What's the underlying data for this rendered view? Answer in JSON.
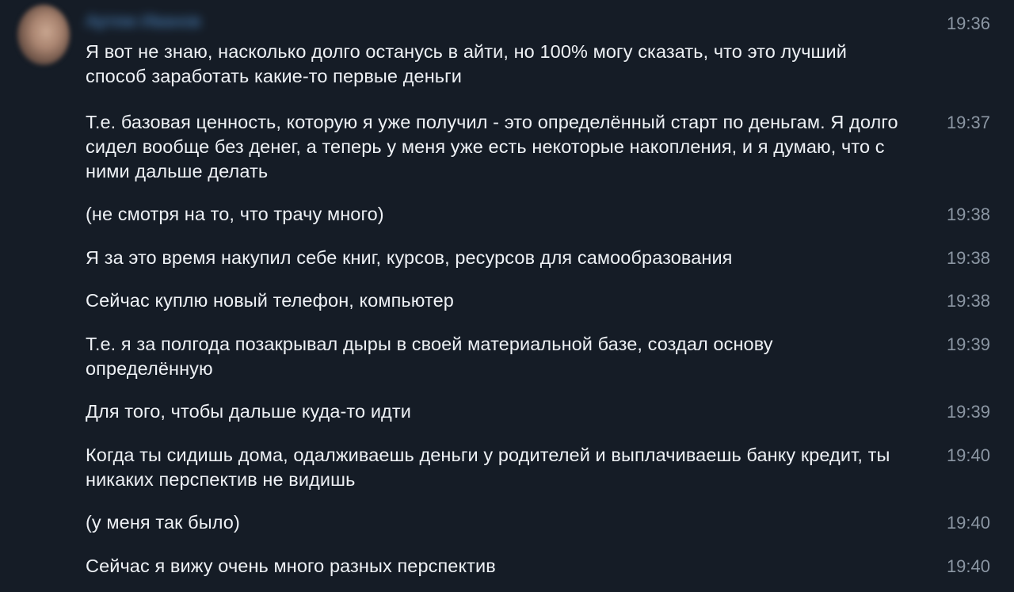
{
  "sender": {
    "name": "Артем Иванов"
  },
  "messages": [
    {
      "text": "Я вот не знаю, насколько долго останусь в айти, но 100% могу сказать, что это лучший способ заработать какие-то первые деньги",
      "time": "19:36"
    },
    {
      "text": "Т.е. базовая ценность, которую я уже получил - это определённый старт по деньгам. Я долго сидел вообще без денег, а теперь у меня уже есть некоторые накопления, и я думаю, что с ними дальше делать",
      "time": "19:37"
    },
    {
      "text": "(не смотря на то, что трачу много)",
      "time": "19:38"
    },
    {
      "text": "Я за это время накупил себе книг, курсов, ресурсов для самообразования",
      "time": "19:38"
    },
    {
      "text": "Сейчас куплю новый телефон, компьютер",
      "time": "19:38"
    },
    {
      "text": "Т.е. я за полгода позакрывал дыры в своей материальной базе, создал основу определённую",
      "time": "19:39"
    },
    {
      "text": "Для того, чтобы дальше куда-то идти",
      "time": "19:39"
    },
    {
      "text": "Когда ты сидишь дома, одалживаешь деньги у родителей и выплачиваешь банку кредит, ты никаких перспектив не видишь",
      "time": "19:40"
    },
    {
      "text": "(у меня так было)",
      "time": "19:40"
    },
    {
      "text": "Сейчас я вижу очень много разных перспектив",
      "time": "19:40"
    }
  ]
}
